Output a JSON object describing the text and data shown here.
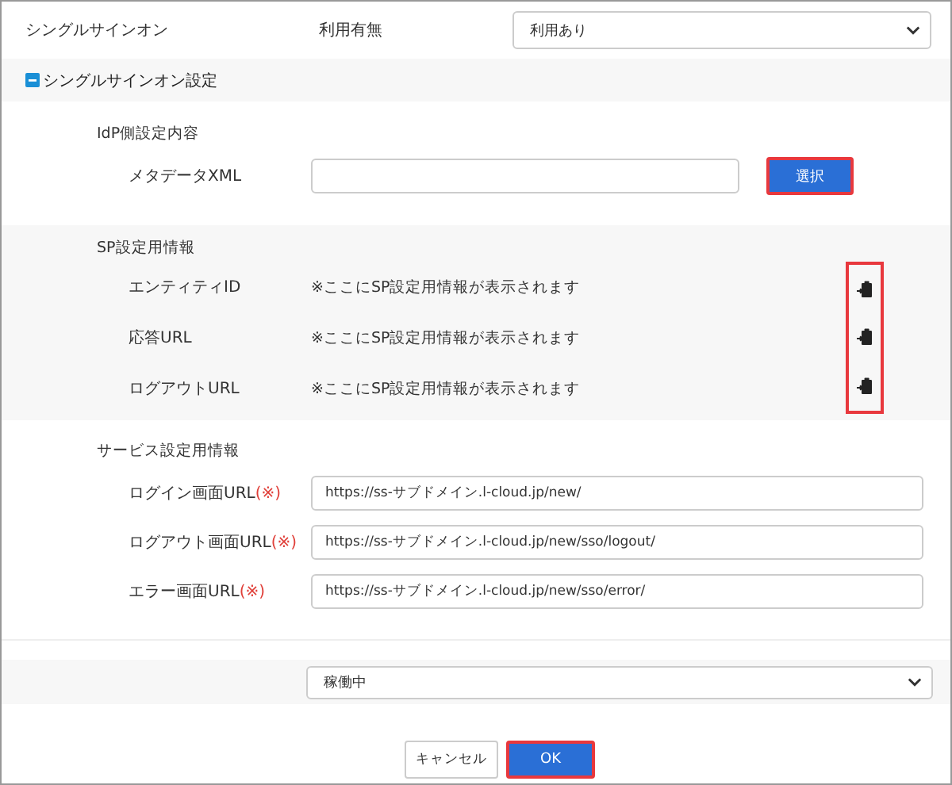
{
  "sso": {
    "label": "シングルサインオン",
    "sublabel": "利用有無",
    "select_value": "利用あり"
  },
  "section": {
    "title": "シングルサインオン設定",
    "expanded": true
  },
  "idp": {
    "heading": "IdP側設定内容",
    "field_label": "メタデータXML",
    "button": "選択",
    "highlighted": true
  },
  "sp": {
    "heading": "SP設定用情報",
    "highlighted": true,
    "rows": [
      {
        "label": "エンティティID",
        "value": "※ここにSP設定用情報が表示されます"
      },
      {
        "label": "応答URL",
        "value": "※ここにSP設定用情報が表示されます"
      },
      {
        "label": "ログアウトURL",
        "value": "※ここにSP設定用情報が表示されます"
      }
    ]
  },
  "service": {
    "heading": "サービス設定用情報",
    "rows": [
      {
        "label": "ログイン画面URL",
        "required_mark": "(※)",
        "value": "https://ss-サブドメイン.l-cloud.jp/new/"
      },
      {
        "label": "ログアウト画面URL",
        "required_mark": "(※)",
        "value": "https://ss-サブドメイン.l-cloud.jp/new/sso/logout/"
      },
      {
        "label": "エラー画面URL",
        "required_mark": "(※)",
        "value": "https://ss-サブドメイン.l-cloud.jp/new/sso/error/"
      }
    ]
  },
  "status_select": {
    "value": "稼働中"
  },
  "buttons": [
    {
      "label": "キャンセル",
      "kind": "secondary",
      "highlighted": false
    },
    {
      "label": "OK",
      "kind": "primary",
      "highlighted": true
    }
  ]
}
